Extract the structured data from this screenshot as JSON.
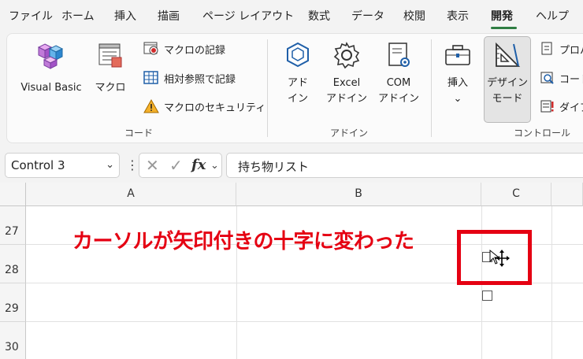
{
  "tabs": [
    "ファイル",
    "ホーム",
    "挿入",
    "描画",
    "ページ レイアウト",
    "数式",
    "データ",
    "校閲",
    "表示",
    "開発",
    "ヘルプ"
  ],
  "ribbon": {
    "code_group": {
      "label": "コード",
      "visual_basic": "Visual Basic",
      "macro": "マクロ",
      "record_macro": "マクロの記録",
      "relative_ref": "相対参照で記録",
      "macro_security": "マクロのセキュリティ"
    },
    "addin_group": {
      "label": "アドイン",
      "addin": "アド\nイン",
      "excel_addin": "Excel\nアドイン",
      "com_addin": "COM\nアドイン"
    },
    "controls_group": {
      "label": "コントロール",
      "insert": "挿入",
      "design_mode": "デザイン\nモード",
      "properties": "プロパ",
      "view_code": "コード",
      "dialog": "ダイア"
    }
  },
  "formula_bar": {
    "name_box": "Control 3",
    "formula": "持ち物リスト"
  },
  "grid": {
    "columns": [
      "A",
      "B",
      "C"
    ],
    "rows": [
      "27",
      "28",
      "29",
      "30"
    ]
  },
  "annotation": "カーソルが矢印付きの十字に変わった",
  "colors": {
    "accent": "#2f7d43",
    "annotation": "#e50012"
  }
}
